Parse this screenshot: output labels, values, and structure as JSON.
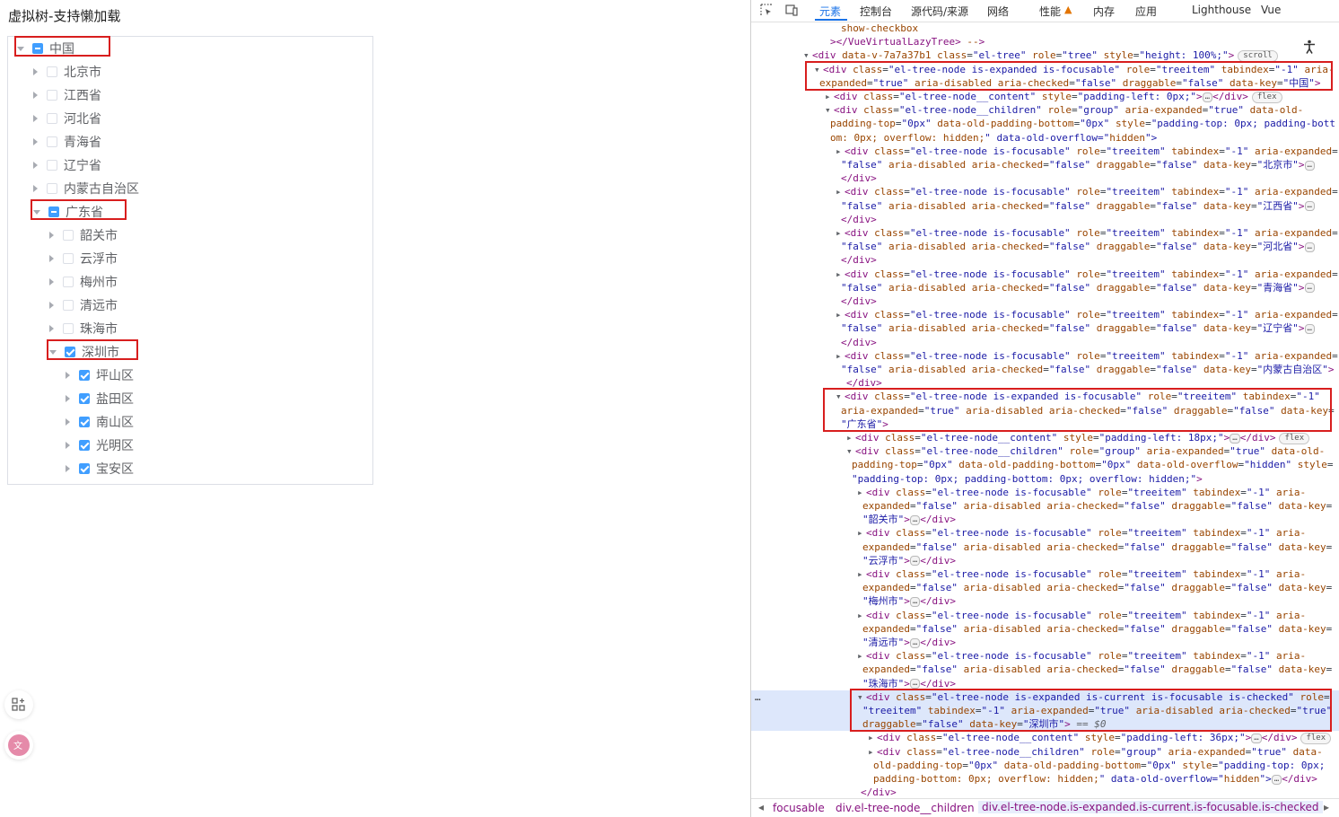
{
  "page": {
    "title": "虚拟树-支持懒加载",
    "tree": [
      {
        "label": "中国",
        "level": 0,
        "expanded": true,
        "check": "indeterminate",
        "highlighted": true
      },
      {
        "label": "北京市",
        "level": 1,
        "expanded": false,
        "check": "unchecked",
        "highlighted": false
      },
      {
        "label": "江西省",
        "level": 1,
        "expanded": false,
        "check": "unchecked",
        "highlighted": false
      },
      {
        "label": "河北省",
        "level": 1,
        "expanded": false,
        "check": "unchecked",
        "highlighted": false
      },
      {
        "label": "青海省",
        "level": 1,
        "expanded": false,
        "check": "unchecked",
        "highlighted": false
      },
      {
        "label": "辽宁省",
        "level": 1,
        "expanded": false,
        "check": "unchecked",
        "highlighted": false
      },
      {
        "label": "内蒙古自治区",
        "level": 1,
        "expanded": false,
        "check": "unchecked",
        "highlighted": false
      },
      {
        "label": "广东省",
        "level": 1,
        "expanded": true,
        "check": "indeterminate",
        "highlighted": true
      },
      {
        "label": "韶关市",
        "level": 2,
        "expanded": false,
        "check": "unchecked",
        "highlighted": false
      },
      {
        "label": "云浮市",
        "level": 2,
        "expanded": false,
        "check": "unchecked",
        "highlighted": false
      },
      {
        "label": "梅州市",
        "level": 2,
        "expanded": false,
        "check": "unchecked",
        "highlighted": false
      },
      {
        "label": "清远市",
        "level": 2,
        "expanded": false,
        "check": "unchecked",
        "highlighted": false
      },
      {
        "label": "珠海市",
        "level": 2,
        "expanded": false,
        "check": "unchecked",
        "highlighted": false
      },
      {
        "label": "深圳市",
        "level": 2,
        "expanded": true,
        "check": "checked",
        "highlighted": true
      },
      {
        "label": "坪山区",
        "level": 3,
        "expanded": false,
        "check": "checked",
        "highlighted": false
      },
      {
        "label": "盐田区",
        "level": 3,
        "expanded": false,
        "check": "checked",
        "highlighted": false
      },
      {
        "label": "南山区",
        "level": 3,
        "expanded": false,
        "check": "checked",
        "highlighted": false
      },
      {
        "label": "光明区",
        "level": 3,
        "expanded": false,
        "check": "checked",
        "highlighted": false
      },
      {
        "label": "宝安区",
        "level": 3,
        "expanded": false,
        "check": "checked",
        "highlighted": false
      }
    ],
    "side_icons": [
      "grid-add-icon",
      "translate-icon"
    ],
    "colors": {
      "accent": "#409eff",
      "highlight": "#d81e1e"
    }
  },
  "devtools": {
    "tabs": [
      "元素",
      "控制台",
      "源代码/来源",
      "网络",
      "性能",
      "内存",
      "应用",
      "Lighthouse",
      "Vue"
    ],
    "active_tab": "元素",
    "warning_tab": "性能",
    "badges": {
      "scroll": "scroll",
      "flex": "flex",
      "ellipsis": "…",
      "selected_ref": "== $0",
      "row_marker": "…"
    },
    "lines": [
      "show-checkbox",
      "></VueVirtualLazyTree> -->",
      "<div data-v-7a7a37b1 class=\"el-tree\" role=\"tree\" style=\"height: 100%;\">",
      "<div class=\"el-tree-node is-expanded is-focusable\" role=\"treeitem\" tabindex=\"-1\" aria-",
      "expanded=\"true\" aria-disabled aria-checked=\"false\" draggable=\"false\" data-key=\"中国\">",
      "<div class=\"el-tree-node__content\" style=\"padding-left: 0px;\">",
      "</div>",
      "<div class=\"el-tree-node__children\" role=\"group\" aria-expanded=\"true\" data-old-",
      "padding-top=\"0px\" data-old-padding-bottom=\"0px\" style=\"padding-top: 0px; padding-bott",
      "om: 0px; overflow: hidden;\" data-old-overflow=\"hidden\">",
      "<div class=\"el-tree-node is-focusable\" role=\"treeitem\" tabindex=\"-1\" aria-expanded=",
      "\"false\" aria-disabled aria-checked=\"false\" draggable=\"false\" data-key=\"北京市\">",
      "\"false\" aria-disabled aria-checked=\"false\" draggable=\"false\" data-key=\"江西省\">",
      "\"false\" aria-disabled aria-checked=\"false\" draggable=\"false\" data-key=\"河北省\">",
      "\"false\" aria-disabled aria-checked=\"false\" draggable=\"false\" data-key=\"青海省\">",
      "\"false\" aria-disabled aria-checked=\"false\" draggable=\"false\" data-key=\"辽宁省\">",
      "\"false\" aria-disabled aria-checked=\"false\" draggable=\"false\" data-key=\"内蒙古自治区\">",
      "<div class=\"el-tree-node is-expanded is-focusable\" role=\"treeitem\" tabindex=\"-1\"",
      "aria-expanded=\"true\" aria-disabled aria-checked=\"false\" draggable=\"false\" data-key=",
      "\"广东省\">",
      "<div class=\"el-tree-node__content\" style=\"padding-left: 18px;\">",
      "<div class=\"el-tree-node__children\" role=\"group\" aria-expanded=\"true\" data-old-",
      "padding-top=\"0px\" data-old-padding-bottom=\"0px\" data-old-overflow=\"hidden\" style=",
      "\"padding-top: 0px; padding-bottom: 0px; overflow: hidden;\">",
      "<div class=\"el-tree-node is-focusable\" role=\"treeitem\" tabindex=\"-1\" aria-",
      "expanded=\"false\" aria-disabled aria-checked=\"false\" draggable=\"false\" data-key=",
      "\"韶关市\">",
      "\"云浮市\">",
      "\"梅州市\">",
      "\"清远市\">",
      "\"珠海市\">",
      "<div class=\"el-tree-node is-expanded is-current is-focusable is-checked\" role=",
      "\"treeitem\" tabindex=\"-1\" aria-expanded=\"true\" aria-disabled aria-checked=\"true\"",
      "draggable=\"false\" data-key=\"深圳市\">",
      "<div class=\"el-tree-node__content\" style=\"padding-left: 36px;\">",
      "<div class=\"el-tree-node__children\" role=\"group\" aria-expanded=\"true\" data-",
      "old-padding-top=\"0px\" data-old-padding-bottom=\"0px\" style=\"padding-top: 0px;",
      "padding-bottom: 0px; overflow: hidden;\" data-old-overflow=\"hidden\">",
      "</div>"
    ],
    "breadcrumbs": [
      "focusable",
      "div.el-tree-node__children",
      "div.el-tree-node.is-expanded.is-current.is-focusable.is-checked"
    ]
  }
}
